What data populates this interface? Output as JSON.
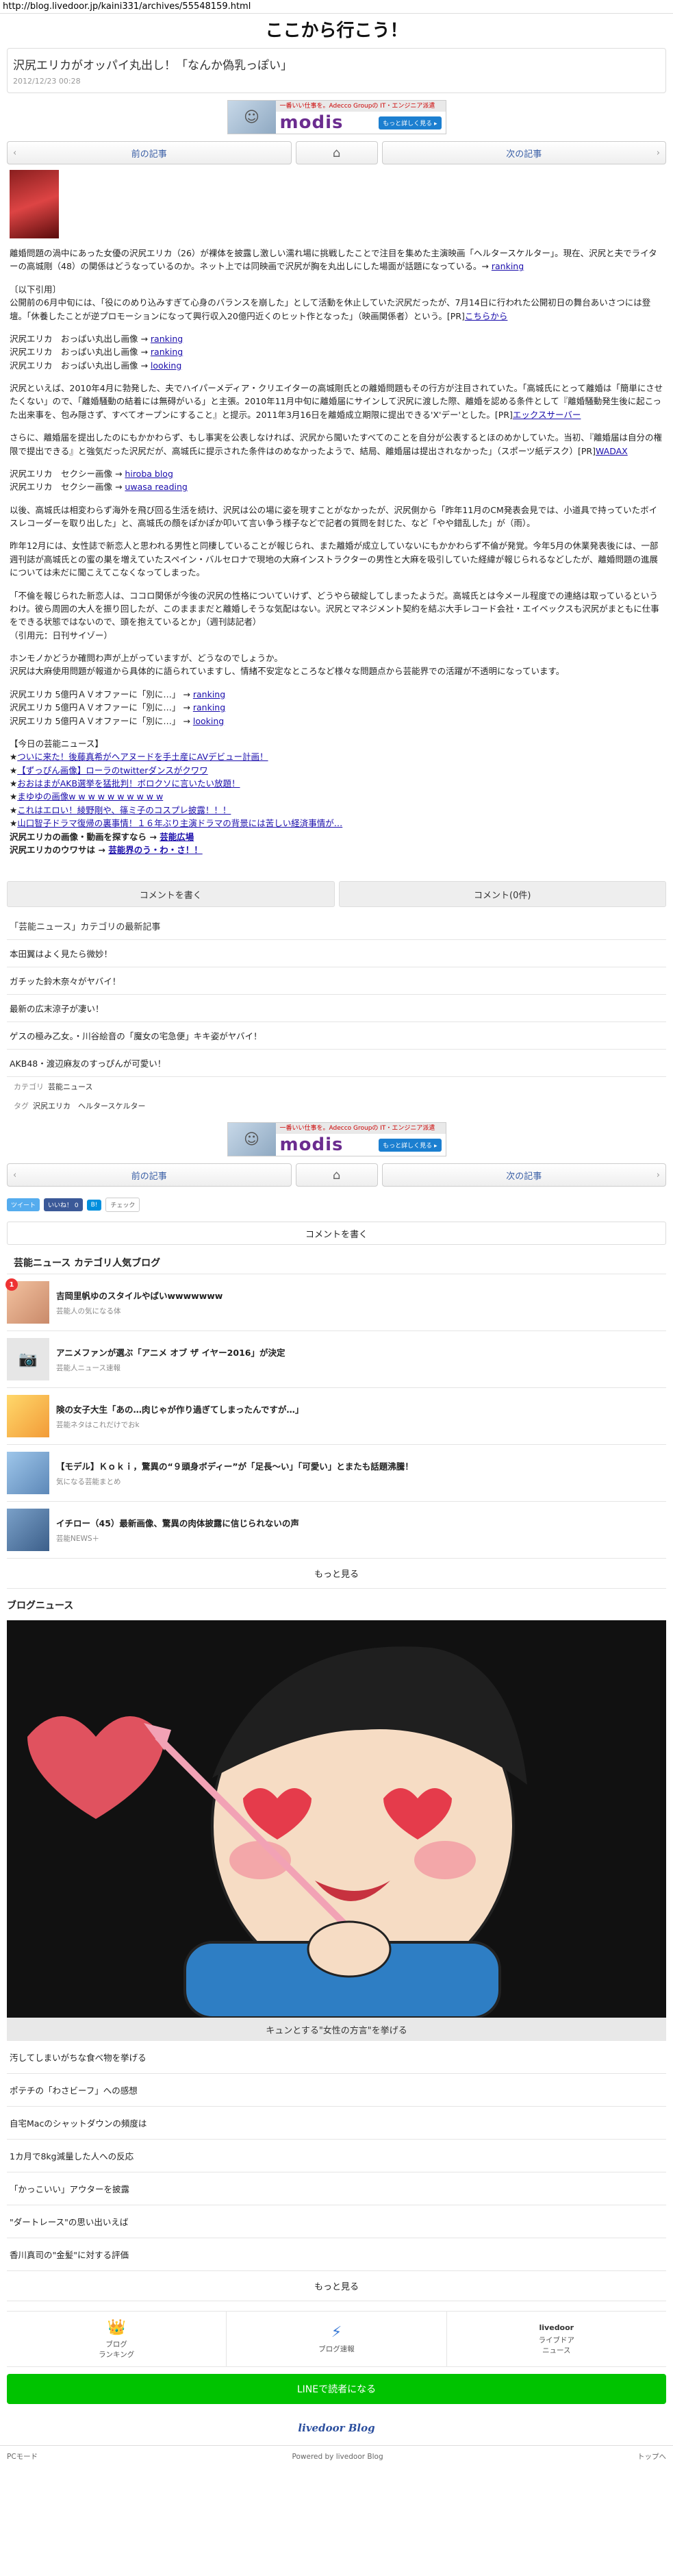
{
  "url": "http://blog.livedoor.jp/kaini331/archives/55548159.html",
  "blog_title": "ここから行こう！",
  "article": {
    "title": "沢尻エリカがオッパイ丸出し！「なんか偽乳っぽい」",
    "date": "2012/12/23 00:28"
  },
  "ad": {
    "top_text": "一番いい仕事を。Adecco Groupの IT・エンジニア派遣",
    "logo": "modis",
    "cta": "もっと詳しく見る ▸"
  },
  "pager": {
    "prev": "前の記事",
    "home_icon": "⌂",
    "next": "次の記事"
  },
  "body": {
    "p1": "離婚問題の渦中にあった女優の沢尻エリカ（26）が裸体を披露し激しい濡れ場に挑戦したことで注目を集めた主演映画「ヘルタースケルター」。現在、沢尻と夫でライターの高城剛（48）の関係はどうなっているのか。ネット上では同映画で沢尻が胸を丸出しにした場面が話題になっている。→",
    "p1_link": "ranking",
    "quote_head": "〔以下引用〕",
    "p2": "公開前の6月中旬には、「役にのめり込みすぎて心身のバランスを崩した」として活動を休止していた沢尻だったが、7月14日に行われた公開初日の舞台あいさつには登壇。「休養したことが逆プロモーションになって興行収入20億円近くのヒット作となった」（映画関係者）という。[PR]",
    "p2_link": "こちらから",
    "links1": [
      {
        "pre": "沢尻エリカ　おっぱい丸出し画像 → ",
        "link": "ranking"
      },
      {
        "pre": "沢尻エリカ　おっぱい丸出し画像 → ",
        "link": "ranking"
      },
      {
        "pre": "沢尻エリカ　おっぱい丸出し画像 → ",
        "link": "looking"
      }
    ],
    "p3": "沢尻といえば、2010年4月に勃発した、夫でハイパーメディア・クリエイターの高城剛氏との離婚問題もその行方が注目されていた。「高城氏にとって離婚は「簡単にさせたくない」ので、「離婚騒動の結着には無碍がいる」と主張。2010年11月中旬に離婚届にサインして沢尻に渡した際、離婚を認める条件として『離婚騒動発生後に起こった出来事を、包み隠さず、すべてオープンにすること』と提示。2011年3月16日を離婚成立期限に提出できる'X'デー'とした。[PR]",
    "p3_link": "エックスサーバー",
    "p4": "さらに、離婚届を提出したのにもかかわらず、もし事実を公表しなければ、沢尻から聞いたすべてのことを自分が公表するとほのめかしていた。当初、『離婚届は自分の権限で提出できる』と強気だった沢尻だが、高城氏に提示された条件はのめなかったようで、結局、離婚届は提出されなかった」（スポーツ紙デスク）[PR]",
    "p4_link": "WADAX",
    "links2": [
      {
        "pre": "沢尻エリカ　セクシー画像 → ",
        "link": "hiroba blog"
      },
      {
        "pre": "沢尻エリカ　セクシー画像 → ",
        "link": "uwasa reading"
      }
    ],
    "p5": "以後、高城氏は相変わらず海外を飛び回る生活を続け、沢尻は公の場に姿を現すことがなかったが、沢尻側から「昨年11月のCM発表会見では、小道具で持っていたボイスレコーダーを取り出した」と、高城氏の顔をぽかぽか叩いて言い争う様子などで記者の質問を封じた、など「やや錯乱した」が（雨）。",
    "p6": "昨年12月には、女性誌で新恋人と思われる男性と同棲していることが報じられ、また離婚が成立していないにもかかわらず不倫が発覚。今年5月の休業発表後には、一部週刊誌が高城氏との蜜の巣を増えていたスペイン・バルセロナで現地の大麻インストラクターの男性と大麻を吸引していた経緯が報じられるなどしたが、離婚問題の進展については未だに聞こえてこなくなってしまった。",
    "p7": "「不倫を報じられた新恋人は、ココロ関係が今後の沢尻の性格についていけず、どうやら破綻してしまったようだ。高城氏とは今メール程度での連絡は取っているというわけ。彼ら周囲の大人を振り回したが、このまままだと離婚しそうな気配はない。沢尻とマネジメント契約を結ぶ大手レコード会社・エイベックスも沢尻がまともに仕事をできる状態ではないので、頭を抱えているとか」（週刊誌記者）",
    "p7_source": "（引用元：日刊サイゾー）",
    "p8_a": "ホンモノかどうか確問わ声が上がっていますが、どうなのでしょうか。",
    "p8_b": "沢尻は大麻使用問題が報道から具体的に語られていますし、情緒不安定なところなど様々な問題点から芸能界での活躍が不透明になっています。",
    "links3": [
      {
        "pre": "沢尻エリカ 5億円ＡＶオファーに「別に…」 → ",
        "link": "ranking"
      },
      {
        "pre": "沢尻エリカ 5億円ＡＶオファーに「別に…」 → ",
        "link": "ranking"
      },
      {
        "pre": "沢尻エリカ 5億円ＡＶオファーに「別に…」 → ",
        "link": "looking"
      }
    ],
    "today_head": "【今日の芸能ニュース】",
    "today": [
      "ついに来た！後藤真希がヘアヌードを手土産にAVデビュー計画！",
      "【ずっぴん画像】ローラのtwitterダンスがクワワ",
      "おおはまがAKB選挙を猛批判！ボロクソに言いたい放題！",
      "まゆゆの画像w w w w w w w w w w",
      "これはエロい！綾野剛や、篠ミ子のコスプレ披露！！！",
      "山口智子ドラマ復帰の裏事情！１６年ぶり主演ドラマの背景には苦しい経済事情が…"
    ],
    "extra1_pre": "沢尻エリカの画像・動画を探すなら → ",
    "extra1_link": "芸能広場",
    "extra2_pre": "沢尻エリカのウワサは → ",
    "extra2_link": "芸能界のう・わ・さ！！"
  },
  "buttons": {
    "write_comment": "コメントを書く",
    "comments": "コメント(0件)"
  },
  "recent": {
    "title": "「芸能ニュース」カテゴリの最新記事",
    "items": [
      "本田翼はよく見たら微妙！",
      "ガチッた鈴木奈々がヤバイ！",
      "最新の広末涼子が凄い！",
      "ゲスの極み乙女。・川谷絵音の「魔女の宅急便」キキ姿がヤバイ！",
      "AKB48・渡辺麻友のすっぴんが可愛い！"
    ]
  },
  "meta": {
    "category_label": "カテゴリ",
    "category": "芸能ニュース",
    "tags_label": "タグ",
    "tags": "沢尻エリカ　ヘルタースケルター"
  },
  "share": {
    "twitter": "ツイート",
    "fb_like": "いいね！ 0",
    "hatebu": "B!",
    "check": "チェック"
  },
  "write_comment2": "コメントを書く",
  "ranking": {
    "title": "芸能ニュース カテゴリ人気ブログ",
    "items": [
      {
        "rank": "1",
        "title": "吉岡里帆ゆのスタイルやばいwwwwwww",
        "sub": "芸能人の気になる体"
      },
      {
        "rank": "",
        "title": "アニメファンが選ぶ「アニメ オブ ザ イヤー2016」が決定",
        "sub": "芸能人ニュース速報"
      },
      {
        "rank": "",
        "title": "険の女子大生「あの…肉じゃが作り過ぎてしまったんですが…」",
        "sub": "芸能ネタはこれだけでおk"
      },
      {
        "rank": "",
        "title": "【モデル】Ｋｏｋｉ，驚異の“９頭身ボディー”が「足長〜い」「可愛い」とまたも話題沸騰！",
        "sub": "気になる芸能まとめ"
      },
      {
        "rank": "",
        "title": "イチロー（45）最新画像、驚異の肉体披露に信じられないの声",
        "sub": "芸能NEWS＋"
      }
    ],
    "more": "もっと見る"
  },
  "blognews": {
    "title": "ブログニュース",
    "caption": "キュンとする\"女性の方言\"を挙げる",
    "items": [
      "汚してしまいがちな食べ物を挙げる",
      "ポテチの「わさビーフ」への感想",
      "自宅Macのシャットダウンの頻度は",
      "1カ月で8kg減量した人への反応",
      "「かっこいい」アウターを披露",
      "\"ダートレース\"の思い出いえば",
      "香川真司の\"金髪\"に対する評価"
    ],
    "more": "もっと見る"
  },
  "footer_nav": [
    {
      "icon": "👑",
      "label": "ブログ\nランキング"
    },
    {
      "icon": "⚡",
      "label": "ブログ速報"
    },
    {
      "icon": "livedoor",
      "label": "ライブドア\nニュース"
    }
  ],
  "line_button": "LINEで読者になる",
  "ld_logo": "livedoor Blog",
  "bottom": {
    "left": "PCモード",
    "center": "Powered by livedoor Blog",
    "right": "トップへ"
  },
  "colors": {
    "accent": "#3a5fa6",
    "line_green": "#00c300",
    "link": "#1a0dab"
  }
}
